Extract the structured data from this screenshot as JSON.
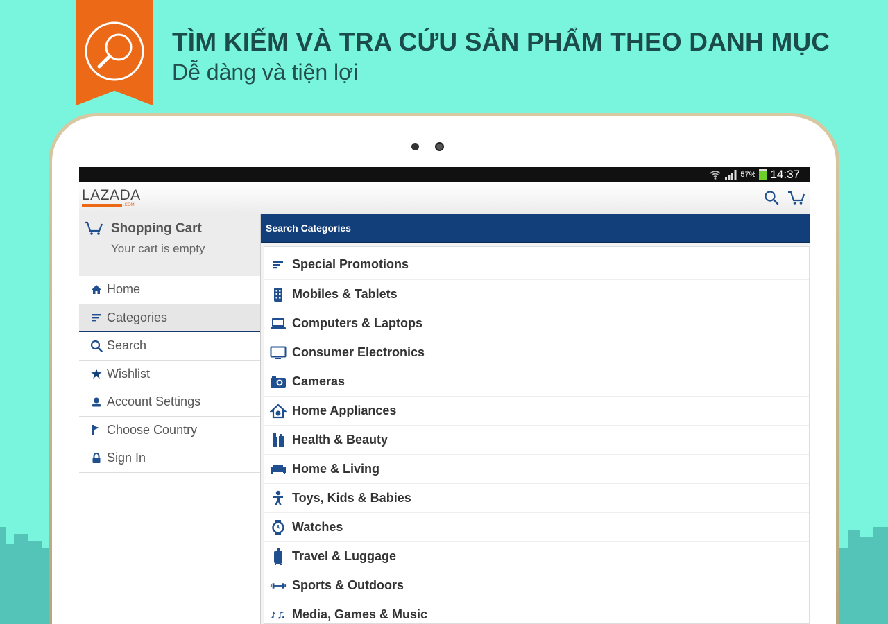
{
  "banner": {
    "headline": "TÌM KIẾM VÀ TRA CỨU SẢN PHẨM THEO DANH MỤC",
    "subline": "Dễ dàng và tiện lợi",
    "ribbon_icon": "magnifier-icon",
    "ribbon_color": "#ec6a17",
    "background_color": "#78f5dc"
  },
  "status_bar": {
    "battery": "57%",
    "time": "14:37"
  },
  "app_bar": {
    "logo_text": "LAZADA",
    "logo_suffix": ".COM",
    "icons": [
      "search-icon",
      "cart-icon"
    ]
  },
  "drawer": {
    "cart": {
      "title": "Shopping Cart",
      "subtitle": "Your cart is empty"
    },
    "items": [
      {
        "label": "Home",
        "icon": "home-icon"
      },
      {
        "label": "Categories",
        "icon": "categories-icon",
        "active": true
      },
      {
        "label": "Search",
        "icon": "search-icon"
      },
      {
        "label": "Wishlist",
        "icon": "star-icon"
      },
      {
        "label": "Account Settings",
        "icon": "user-icon"
      },
      {
        "label": "Choose Country",
        "icon": "flag-icon"
      },
      {
        "label": "Sign In",
        "icon": "lock-icon"
      }
    ]
  },
  "categories": {
    "header": "Search Categories",
    "items": [
      {
        "label": "Special Promotions",
        "icon": "promotions-icon"
      },
      {
        "label": "Mobiles & Tablets",
        "icon": "mobile-icon"
      },
      {
        "label": "Computers & Laptops",
        "icon": "laptop-icon"
      },
      {
        "label": "Consumer Electronics",
        "icon": "monitor-icon"
      },
      {
        "label": "Cameras",
        "icon": "camera-icon"
      },
      {
        "label": "Home Appliances",
        "icon": "home-appliance-icon"
      },
      {
        "label": "Health & Beauty",
        "icon": "beauty-icon"
      },
      {
        "label": "Home & Living",
        "icon": "sofa-icon"
      },
      {
        "label": "Toys, Kids & Babies",
        "icon": "baby-icon"
      },
      {
        "label": "Watches",
        "icon": "watch-icon"
      },
      {
        "label": "Travel & Luggage",
        "icon": "luggage-icon"
      },
      {
        "label": "Sports & Outdoors",
        "icon": "dumbbell-icon"
      },
      {
        "label": "Media, Games & Music",
        "icon": "music-icon"
      }
    ]
  },
  "colors": {
    "accent_blue": "#123e7a",
    "brand_orange": "#ec6a17",
    "icon_blue": "#1f4f8f"
  }
}
